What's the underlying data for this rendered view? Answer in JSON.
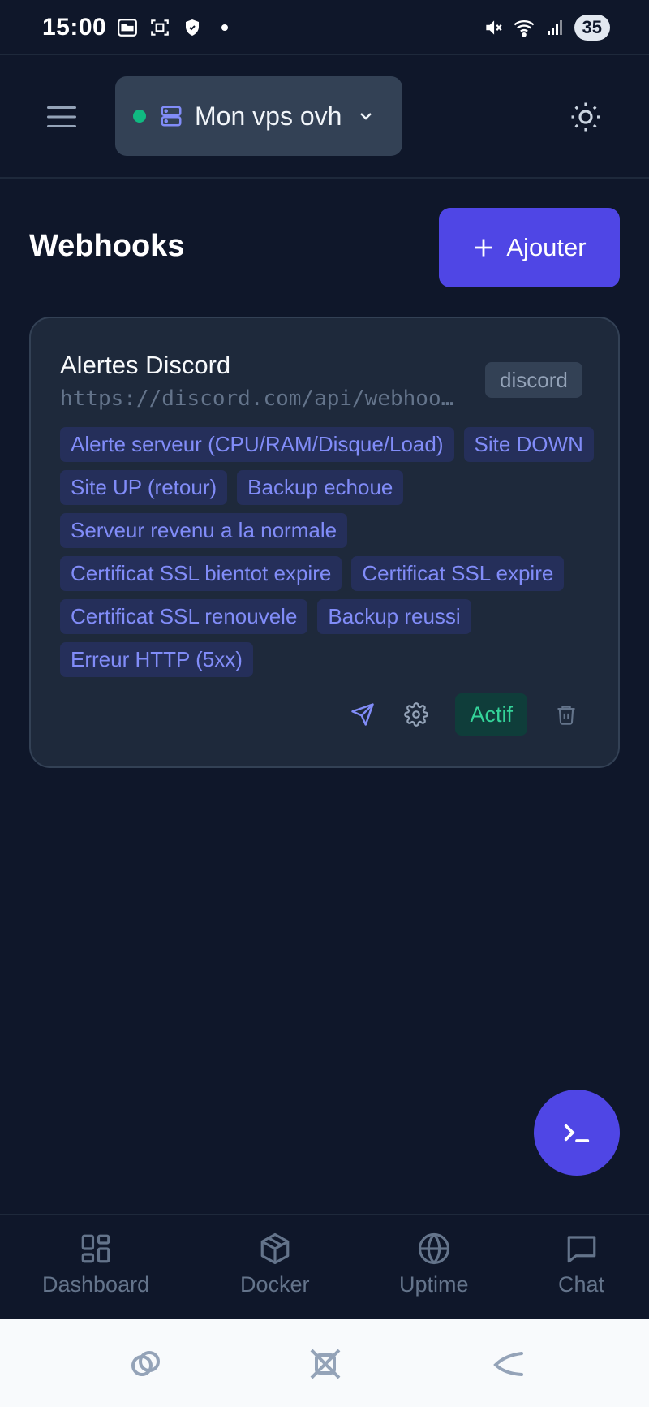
{
  "status_bar": {
    "time": "15:00",
    "battery": "35"
  },
  "header": {
    "server_name": "Mon vps ovh",
    "server_status_color": "#10b981"
  },
  "page": {
    "title": "Webhooks",
    "add_label": "Ajouter"
  },
  "webhook": {
    "name": "Alertes Discord",
    "url": "https://discord.com/api/webhoo…",
    "type": "discord",
    "events": [
      "Alerte serveur (CPU/RAM/Disque/Load)",
      "Site DOWN",
      "Site UP (retour)",
      "Backup echoue",
      "Serveur revenu a la normale",
      "Certificat SSL bientot expire",
      "Certificat SSL expire",
      "Certificat SSL renouvele",
      "Backup reussi",
      "Erreur HTTP (5xx)"
    ],
    "status_label": "Actif"
  },
  "bottom_nav": {
    "items": [
      {
        "label": "Dashboard",
        "icon": "grid-icon"
      },
      {
        "label": "Docker",
        "icon": "box-icon"
      },
      {
        "label": "Uptime",
        "icon": "globe-icon"
      },
      {
        "label": "Chat",
        "icon": "chat-icon"
      }
    ]
  },
  "colors": {
    "background": "#0f172a",
    "accent": "#4f46e5",
    "card": "#1e293b",
    "tag_text": "#818cf8",
    "active": "#34d399"
  }
}
